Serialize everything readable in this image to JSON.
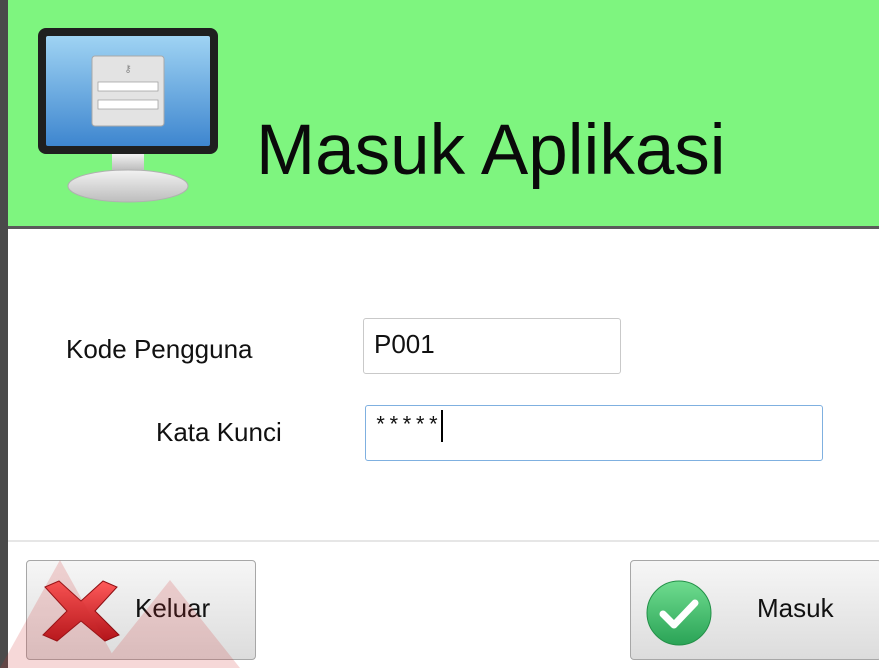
{
  "header": {
    "title": "Masuk Aplikasi",
    "icon": "monitor-login-icon",
    "background": "#7ef57f"
  },
  "form": {
    "kode_label": "Kode Pengguna",
    "kode_value": "P001",
    "kata_label": "Kata Kunci",
    "kata_value": "*****"
  },
  "buttons": {
    "keluar_label": "Keluar",
    "keluar_icon": "red-x-icon",
    "masuk_label": "Masuk",
    "masuk_icon": "green-check-icon"
  },
  "colors": {
    "keluar_icon": "#d9232a",
    "masuk_icon": "#3cbf6a"
  }
}
